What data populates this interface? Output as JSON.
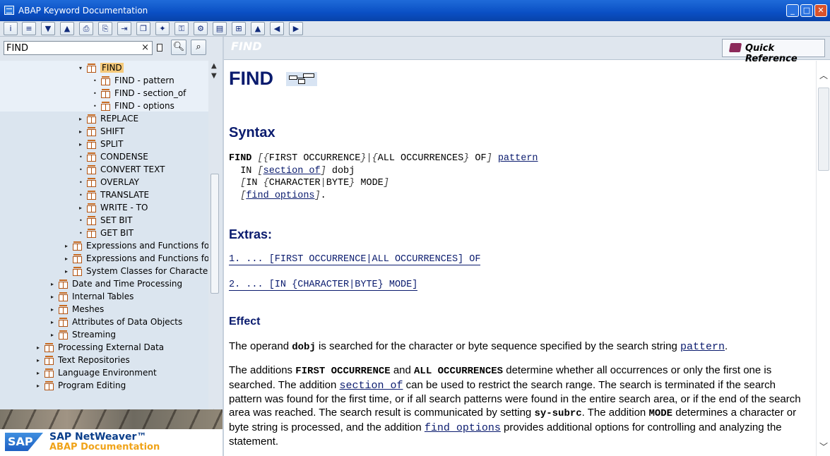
{
  "window": {
    "title": "ABAP Keyword Documentation"
  },
  "search": {
    "value": "FIND",
    "clear": "×"
  },
  "tree": {
    "items": [
      {
        "label": "FIND",
        "level": 3,
        "arrow": "▾",
        "selected": true
      },
      {
        "label": "FIND - pattern",
        "level": 4,
        "arrow": "•"
      },
      {
        "label": "FIND - section_of",
        "level": 4,
        "arrow": "•"
      },
      {
        "label": "FIND - options",
        "level": 4,
        "arrow": "•"
      },
      {
        "label": "REPLACE",
        "level": 3,
        "arrow": "▸"
      },
      {
        "label": "SHIFT",
        "level": 3,
        "arrow": "▸"
      },
      {
        "label": "SPLIT",
        "level": 3,
        "arrow": "▸"
      },
      {
        "label": "CONDENSE",
        "level": 3,
        "arrow": "•"
      },
      {
        "label": "CONVERT TEXT",
        "level": 3,
        "arrow": "•"
      },
      {
        "label": "OVERLAY",
        "level": 3,
        "arrow": "•"
      },
      {
        "label": "TRANSLATE",
        "level": 3,
        "arrow": "•"
      },
      {
        "label": "WRITE - TO",
        "level": 3,
        "arrow": "▸"
      },
      {
        "label": "SET BIT",
        "level": 3,
        "arrow": "•"
      },
      {
        "label": "GET BIT",
        "level": 3,
        "arrow": "•"
      },
      {
        "label": "Expressions and Functions for S",
        "level": 2,
        "arrow": "▸"
      },
      {
        "label": "Expressions and Functions for B",
        "level": 2,
        "arrow": "▸"
      },
      {
        "label": "System Classes for Character St",
        "level": 2,
        "arrow": "▸"
      },
      {
        "label": "Date and Time Processing",
        "level": 1,
        "arrow": "▸"
      },
      {
        "label": "Internal Tables",
        "level": 1,
        "arrow": "▸"
      },
      {
        "label": "Meshes",
        "level": 1,
        "arrow": "▸"
      },
      {
        "label": "Attributes of Data Objects",
        "level": 1,
        "arrow": "▸"
      },
      {
        "label": "Streaming",
        "level": 1,
        "arrow": "▸"
      },
      {
        "label": "Processing External Data",
        "level": 0,
        "arrow": "▸"
      },
      {
        "label": "Text Repositories",
        "level": 0,
        "arrow": "▸"
      },
      {
        "label": "Language Environment",
        "level": 0,
        "arrow": "▸"
      },
      {
        "label": "Program Editing",
        "level": 0,
        "arrow": "▸"
      }
    ]
  },
  "brand": {
    "logo": "SAP",
    "line1": "SAP NetWeaver™",
    "line2": "ABAP Documentation"
  },
  "content": {
    "header_title": "FIND",
    "quick_ref": "Quick Reference",
    "title": "FIND",
    "syntax_heading": "Syntax",
    "extras_heading": "Extras:",
    "extra1": "1. ... [FIRST OCCURRENCE|ALL OCCURRENCES] OF",
    "extra2": "2. ... [IN {CHARACTER|BYTE} MODE]",
    "effect_heading": "Effect",
    "effect_p1_a": "The operand ",
    "effect_p1_b": "dobj",
    "effect_p1_c": " is searched for the character or byte sequence specified by the search string ",
    "effect_p1_link": "pattern",
    "effect_p1_d": ".",
    "p2_a": "The additions ",
    "p2_b": "FIRST OCCURRENCE",
    "p2_c": " and ",
    "p2_d": "ALL OCCURRENCES",
    "p2_e": " determine whether all occurrences or only the first one is searched. The addition ",
    "p2_link1": "section of",
    "p2_f": " can be used to restrict the search range. The search is terminated if the search pattern was found for the first time, or if all search patterns were found in the entire search area, or if the end of the search area was reached. The search result is communicated by setting ",
    "p2_g": "sy-subrc",
    "p2_h": ". The addition ",
    "p2_i": "MODE",
    "p2_j": " determines a character or byte string is processed, and the addition ",
    "p2_link2": "find options",
    "p2_k": " provides additional options for controlling and analyzing the statement."
  }
}
